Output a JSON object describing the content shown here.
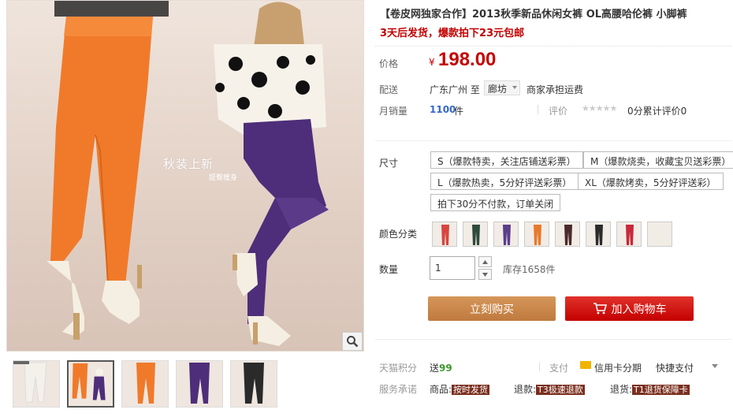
{
  "main_image": {
    "overlay_title": "秋装上新",
    "overlay_subtitle": "提臀瘦身"
  },
  "thumbnails": [
    "white",
    "orange",
    "orange",
    "purple",
    "black"
  ],
  "product": {
    "title": "【卷皮网独家合作】2013秋季新品休闲女裤 OL高腰哈伦裤 小脚裤",
    "promo": "3天后发货，爆款拍下23元包邮"
  },
  "price": {
    "label": "价格",
    "currency": "¥",
    "value": "198.00"
  },
  "shipping": {
    "label": "配送",
    "from": "广东广州 至",
    "destination": "廊坊",
    "note": "商家承担运费"
  },
  "sales": {
    "label": "月销量",
    "count": "1100",
    "unit": "件",
    "review_label": "评价",
    "stars": "★★★★★",
    "rating_text": "0分累计评价0"
  },
  "size": {
    "label": "尺寸",
    "options": [
      "S（爆款特卖，关注店铺送彩票）",
      "M（爆款烧卖，收藏宝贝送彩票）",
      "L（爆款热卖，5分好评送彩票）",
      "XL（爆款烤卖，5分好评送彩）",
      "拍下30分不付款，订单关闭"
    ]
  },
  "color": {
    "label": "颜色分类",
    "swatches": [
      "#d9443f",
      "#2d4a3b",
      "#5b3d8a",
      "#e8792b",
      "#4a2a2a",
      "#2b2b2b",
      "#c8283a",
      "#f1ede4"
    ]
  },
  "quantity": {
    "label": "数量",
    "value": "1",
    "stock": "库存1658件"
  },
  "actions": {
    "buy_now": "立刻购买",
    "add_to_cart": "加入购物车"
  },
  "points": {
    "label": "天猫积分",
    "prefix": "送",
    "value": "99"
  },
  "payment": {
    "label": "支付",
    "credit": "信用卡分期",
    "quick": "快捷支付"
  },
  "service": {
    "label": "服务承诺",
    "goods_prefix": "商品:",
    "goods_badge": "按时发货",
    "refund_prefix": "退款:",
    "refund_badge": "T3极速退款",
    "return_prefix": "退货:",
    "return_badge": "T1退货保障卡"
  },
  "colors": {
    "price_red": "#c40000",
    "buy_button": "#c9874b",
    "cart_button": "#c40000",
    "link_blue": "#3366cc"
  }
}
